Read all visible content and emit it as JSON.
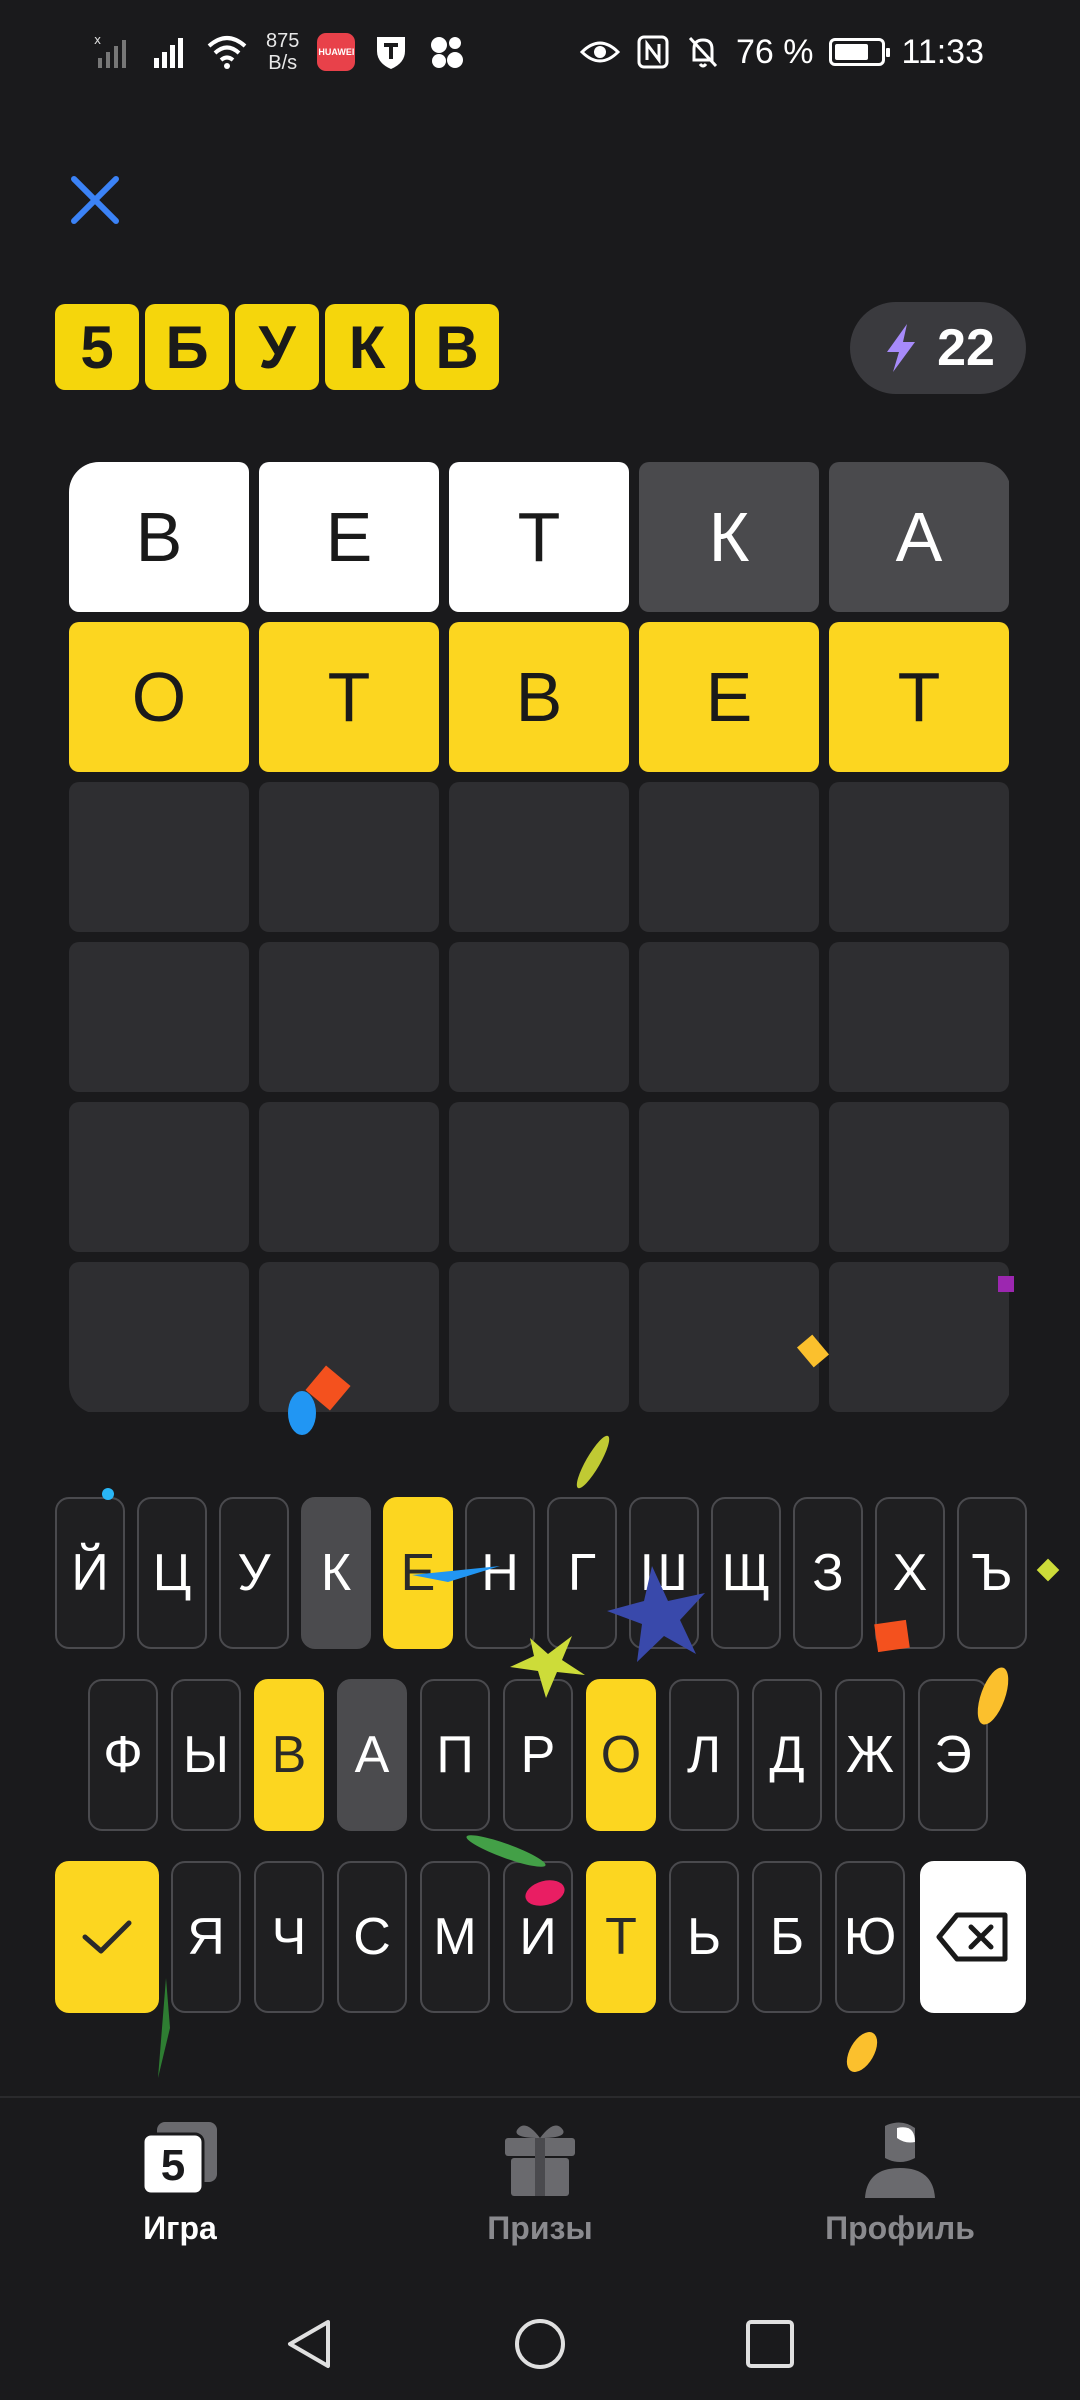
{
  "status_bar": {
    "net_speed_value": "875",
    "net_speed_unit": "B/s",
    "battery_percent": "76 %",
    "battery_level": 0.76,
    "time": "11:33",
    "app_badge_text": "HUAWEI"
  },
  "header": {
    "logo_letters": [
      "5",
      "Б",
      "У",
      "К",
      "В"
    ],
    "energy_count": "22"
  },
  "board": {
    "rows": [
      [
        {
          "letter": "В",
          "state": "white"
        },
        {
          "letter": "Е",
          "state": "white"
        },
        {
          "letter": "Т",
          "state": "white"
        },
        {
          "letter": "К",
          "state": "gray"
        },
        {
          "letter": "А",
          "state": "gray"
        }
      ],
      [
        {
          "letter": "О",
          "state": "yellow"
        },
        {
          "letter": "Т",
          "state": "yellow"
        },
        {
          "letter": "В",
          "state": "yellow"
        },
        {
          "letter": "Е",
          "state": "yellow"
        },
        {
          "letter": "Т",
          "state": "yellow"
        }
      ],
      [
        {
          "letter": "",
          "state": "empty"
        },
        {
          "letter": "",
          "state": "empty"
        },
        {
          "letter": "",
          "state": "empty"
        },
        {
          "letter": "",
          "state": "empty"
        },
        {
          "letter": "",
          "state": "empty"
        }
      ],
      [
        {
          "letter": "",
          "state": "empty"
        },
        {
          "letter": "",
          "state": "empty"
        },
        {
          "letter": "",
          "state": "empty"
        },
        {
          "letter": "",
          "state": "empty"
        },
        {
          "letter": "",
          "state": "empty"
        }
      ],
      [
        {
          "letter": "",
          "state": "empty"
        },
        {
          "letter": "",
          "state": "empty"
        },
        {
          "letter": "",
          "state": "empty"
        },
        {
          "letter": "",
          "state": "empty"
        },
        {
          "letter": "",
          "state": "empty"
        }
      ],
      [
        {
          "letter": "",
          "state": "empty"
        },
        {
          "letter": "",
          "state": "empty"
        },
        {
          "letter": "",
          "state": "empty"
        },
        {
          "letter": "",
          "state": "empty"
        },
        {
          "letter": "",
          "state": "empty"
        }
      ]
    ]
  },
  "keyboard": {
    "row1": [
      {
        "label": "Й",
        "state": "default"
      },
      {
        "label": "Ц",
        "state": "default"
      },
      {
        "label": "У",
        "state": "default"
      },
      {
        "label": "К",
        "state": "gray"
      },
      {
        "label": "Е",
        "state": "yellow"
      },
      {
        "label": "Н",
        "state": "default"
      },
      {
        "label": "Г",
        "state": "default"
      },
      {
        "label": "Ш",
        "state": "default"
      },
      {
        "label": "Щ",
        "state": "default"
      },
      {
        "label": "З",
        "state": "default"
      },
      {
        "label": "Х",
        "state": "default"
      },
      {
        "label": "Ъ",
        "state": "default"
      }
    ],
    "row2": [
      {
        "label": "Ф",
        "state": "default"
      },
      {
        "label": "Ы",
        "state": "default"
      },
      {
        "label": "В",
        "state": "yellow"
      },
      {
        "label": "А",
        "state": "gray"
      },
      {
        "label": "П",
        "state": "default"
      },
      {
        "label": "Р",
        "state": "default"
      },
      {
        "label": "О",
        "state": "yellow"
      },
      {
        "label": "Л",
        "state": "default"
      },
      {
        "label": "Д",
        "state": "default"
      },
      {
        "label": "Ж",
        "state": "default"
      },
      {
        "label": "Э",
        "state": "default"
      }
    ],
    "row3": [
      {
        "label": "Я",
        "state": "default"
      },
      {
        "label": "Ч",
        "state": "default"
      },
      {
        "label": "С",
        "state": "default"
      },
      {
        "label": "М",
        "state": "default"
      },
      {
        "label": "И",
        "state": "default"
      },
      {
        "label": "Т",
        "state": "yellow"
      },
      {
        "label": "Ь",
        "state": "default"
      },
      {
        "label": "Б",
        "state": "default"
      },
      {
        "label": "Ю",
        "state": "default"
      }
    ]
  },
  "bottom_nav": {
    "items": [
      {
        "label": "Игра",
        "active": true,
        "icon": "game-icon"
      },
      {
        "label": "Призы",
        "active": false,
        "icon": "gift-icon"
      },
      {
        "label": "Профиль",
        "active": false,
        "icon": "profile-icon"
      }
    ],
    "game_icon_text": "5"
  },
  "colors": {
    "background": "#1a1a1c",
    "yellow": "#fcd620",
    "gray_tile": "#4a4a4d",
    "empty_tile": "#2e2e31",
    "accent_blue": "#3b82f6",
    "energy_bolt": "#a78bfa"
  }
}
